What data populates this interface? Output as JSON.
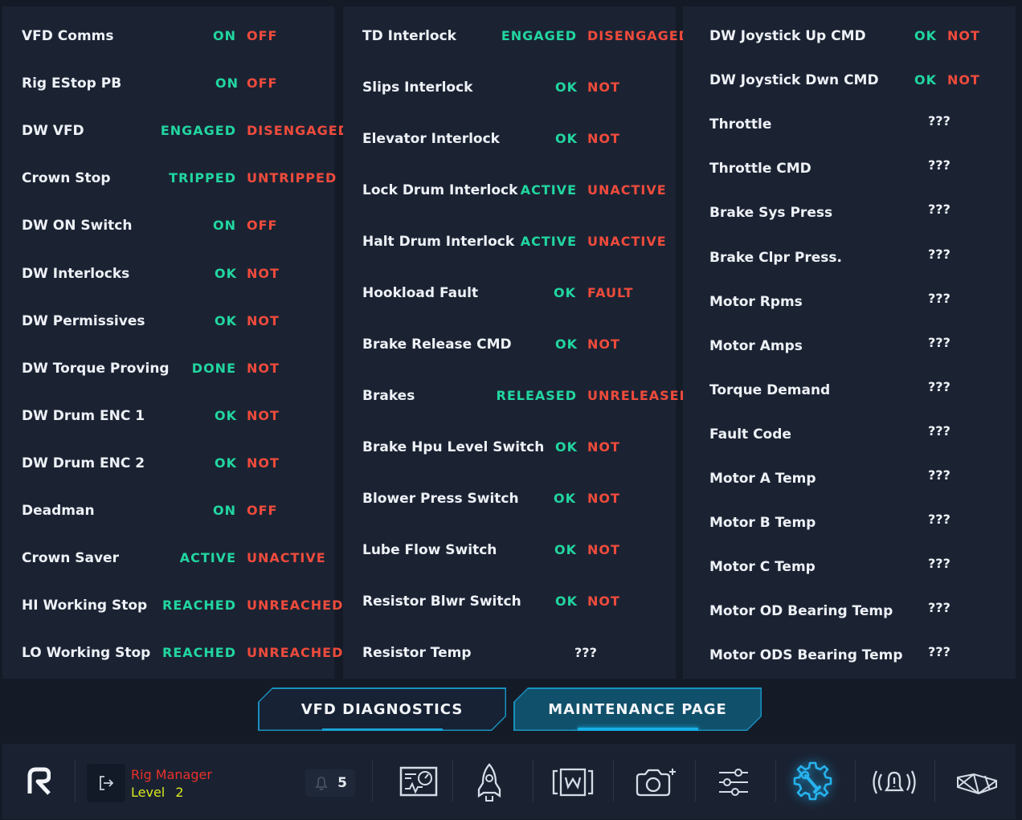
{
  "panel1": [
    {
      "label": "VFD Comms",
      "on": "ON",
      "off": "OFF"
    },
    {
      "label": "Rig EStop PB",
      "on": "ON",
      "off": "OFF"
    },
    {
      "label": "DW VFD",
      "on": "ENGAGED",
      "off": "DISENGAGED"
    },
    {
      "label": "Crown Stop",
      "on": "TRIPPED",
      "off": "UNTRIPPED"
    },
    {
      "label": "DW ON Switch",
      "on": "ON",
      "off": "OFF"
    },
    {
      "label": "DW Interlocks",
      "on": "OK",
      "off": "NOT"
    },
    {
      "label": "DW Permissives",
      "on": "OK",
      "off": "NOT"
    },
    {
      "label": "DW Torque Proving",
      "on": "DONE",
      "off": "NOT"
    },
    {
      "label": "DW Drum ENC 1",
      "on": "OK",
      "off": "NOT"
    },
    {
      "label": "DW Drum ENC 2",
      "on": "OK",
      "off": "NOT"
    },
    {
      "label": "Deadman",
      "on": "ON",
      "off": "OFF"
    },
    {
      "label": "Crown Saver",
      "on": "ACTIVE",
      "off": "UNACTIVE"
    },
    {
      "label": "HI Working Stop",
      "on": "REACHED",
      "off": "UNREACHED"
    },
    {
      "label": "LO Working Stop",
      "on": "REACHED",
      "off": "UNREACHED"
    }
  ],
  "panel2": [
    {
      "label": "TD Interlock",
      "on": "ENGAGED",
      "off": "DISENGAGED"
    },
    {
      "label": "Slips Interlock",
      "on": "OK",
      "off": "NOT"
    },
    {
      "label": "Elevator Interlock",
      "on": "OK",
      "off": "NOT"
    },
    {
      "label": "Lock Drum Interlock",
      "on": "ACTIVE",
      "off": "UNACTIVE"
    },
    {
      "label": "Halt Drum Interlock",
      "on": "ACTIVE",
      "off": "UNACTIVE"
    },
    {
      "label": "Hookload Fault",
      "on": "OK",
      "off": "FAULT"
    },
    {
      "label": "Brake Release CMD",
      "on": "OK",
      "off": "NOT"
    },
    {
      "label": "Brakes",
      "on": "RELEASED",
      "off": "UNRELEASED"
    },
    {
      "label": "Brake Hpu Level Switch",
      "on": "OK",
      "off": "NOT"
    },
    {
      "label": "Blower Press Switch",
      "on": "OK",
      "off": "NOT"
    },
    {
      "label": "Lube Flow Switch",
      "on": "OK",
      "off": "NOT"
    },
    {
      "label": "Resistor Blwr Switch",
      "on": "OK",
      "off": "NOT"
    },
    {
      "label": "Resistor Temp",
      "value": "???"
    }
  ],
  "panel3": [
    {
      "label": "DW Joystick Up CMD",
      "on": "OK",
      "off": "NOT"
    },
    {
      "label": "DW Joystick Dwn CMD",
      "on": "OK",
      "off": "NOT"
    },
    {
      "label": "Throttle",
      "value": "???"
    },
    {
      "label": "Throttle CMD",
      "value": "???"
    },
    {
      "label": "Brake Sys Press",
      "value": "???"
    },
    {
      "label": "Brake Clpr Press.",
      "value": "???"
    },
    {
      "label": "Motor Rpms",
      "value": "???"
    },
    {
      "label": "Motor Amps",
      "value": "???"
    },
    {
      "label": "Torque Demand",
      "value": "???"
    },
    {
      "label": "Fault Code",
      "value": "???"
    },
    {
      "label": "Motor A Temp",
      "value": "???"
    },
    {
      "label": "Motor B Temp",
      "value": "???"
    },
    {
      "label": "Motor C Temp",
      "value": "???"
    },
    {
      "label": "Motor OD Bearing Temp",
      "value": "???"
    },
    {
      "label": "Motor ODS Bearing Temp",
      "value": "???"
    }
  ],
  "tabs": {
    "vfd": "VFD DIAGNOSTICS",
    "maintenance": "MAINTENANCE PAGE",
    "active": "maintenance"
  },
  "bottombar": {
    "logo": "R",
    "user_role": "Rig Manager",
    "level_label": "Level",
    "level_value": "2",
    "notification_count": "5",
    "nav_icons": [
      "diagnostics-screen-icon",
      "rocket-pressure-icon",
      "drawworks-icon",
      "camera-add-icon",
      "sliders-icon",
      "wrench-gear-icon",
      "alarm-bell-icon",
      "rig-structure-icon"
    ],
    "active_nav": "wrench-gear-icon"
  },
  "colors": {
    "ok_green": "#22d6a0",
    "alert_red": "#ef4b3c",
    "accent_blue": "#1792c0",
    "panel_bg": "#1b2333",
    "page_bg": "#141b27"
  }
}
